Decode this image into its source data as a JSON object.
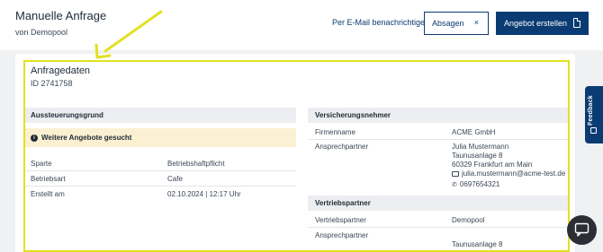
{
  "header": {
    "title": "Manuelle Anfrage",
    "subtitle": "von Demopool",
    "notify_label": "Per E-Mail benachrichtigen",
    "reject_label": "Absagen",
    "reject_icon": "×",
    "offer_label": "Angebot erstellen"
  },
  "card": {
    "title": "Anfragedaten",
    "id_text": "ID 2741758"
  },
  "left": {
    "section_title": "Aussteuerungsgrund",
    "alert_icon": "i",
    "alert_text": "Weitere Angebote gesucht",
    "rows": [
      {
        "label": "Sparte",
        "value": "Betriebshaftpflicht"
      },
      {
        "label": "Betriebsart",
        "value": "Cafe"
      },
      {
        "label": "Erstellt am",
        "value": "02.10.2024 | 12:17 Uhr"
      }
    ]
  },
  "insured": {
    "section_title": "Versicherungsnehmer",
    "company_label": "Firmenname",
    "company_value": "ACME GmbH",
    "contact_label": "Ansprechpartner",
    "contact_name": "Julia Mustermann",
    "contact_street": "Taunusanlage 8",
    "contact_city": "60329 Frankfurt am Main",
    "contact_email": "julia.mustermann@acme-test.de",
    "contact_phone": "0697654321"
  },
  "partner": {
    "section_title": "Vertriebspartner",
    "partner_label": "Vertriebspartner",
    "partner_value": "Demopool",
    "contact_label": "Ansprechpartner",
    "contact_street": "Taunusanlage 8"
  },
  "feedback_label": "Feedback",
  "colors": {
    "primary": "#0b3b73",
    "highlight": "#e2e024",
    "alert_bg": "#fbf1d2",
    "section_bg": "#eceef1"
  }
}
